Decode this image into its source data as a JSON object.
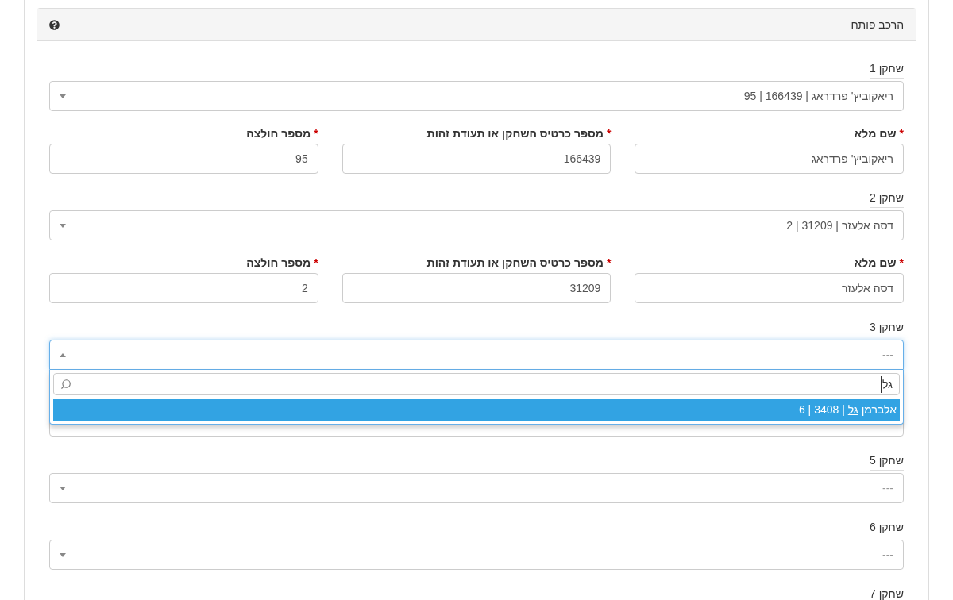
{
  "panel": {
    "title": "הרכב פותח"
  },
  "players": [
    {
      "kind": "select",
      "label": "שחקן 1",
      "value": "ריאקוביץ' פרדראג | 166439 | 95",
      "open": false,
      "fields": [
        {
          "label": "שם מלא",
          "required_mark": "*",
          "value": "ריאקוביץ' פרדראג"
        },
        {
          "label": "מספר כרטיס השחקן או תעודת זהות",
          "required_mark": "*",
          "value": "166439"
        },
        {
          "label": "מספר חולצה",
          "required_mark": "*",
          "value": "95"
        }
      ]
    },
    {
      "kind": "select",
      "label": "שחקן 2",
      "value": "דסה אלעזר | 31209 | 2",
      "open": false,
      "fields": [
        {
          "label": "שם מלא",
          "required_mark": "*",
          "value": "דסה אלעזר"
        },
        {
          "label": "מספר כרטיס השחקן או תעודת זהות",
          "required_mark": "*",
          "value": "31209"
        },
        {
          "label": "מספר חולצה",
          "required_mark": "*",
          "value": "2"
        }
      ]
    },
    {
      "kind": "select",
      "label": "שחקן 3",
      "placeholder": "---",
      "open": true,
      "dropdown": {
        "search_value": "גל",
        "options": [
          {
            "selected": true,
            "parts": [
              {
                "text": "אלברמן ",
                "match": false
              },
              {
                "text": "גל",
                "match": true
              },
              {
                "text": " | 3408 | 6",
                "match": false
              }
            ]
          }
        ]
      }
    },
    {
      "kind": "select",
      "open": false
    },
    {
      "kind": "select",
      "label": "שחקן 5",
      "placeholder": "---",
      "open": false
    },
    {
      "kind": "select",
      "label": "שחקן 6",
      "placeholder": "---",
      "open": false
    },
    {
      "kind": "select",
      "label": "שחקן 7"
    }
  ]
}
